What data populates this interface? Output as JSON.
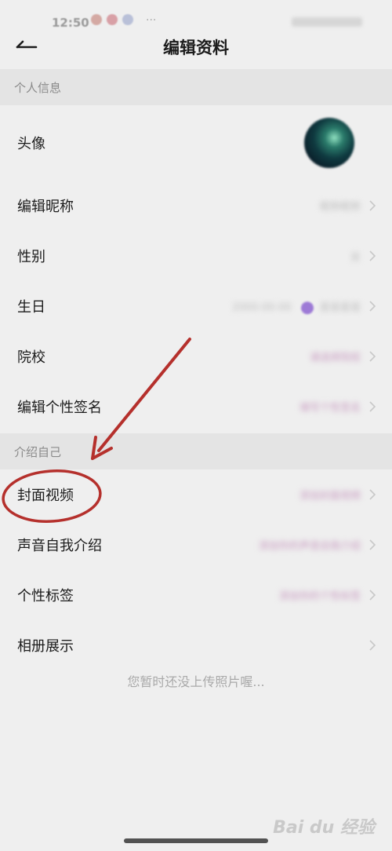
{
  "status_bar": {
    "time": "12:50",
    "more": "···"
  },
  "header": {
    "title": "编辑资料"
  },
  "sections": {
    "personal": {
      "title": "个人信息"
    },
    "intro": {
      "title": "介绍自己"
    }
  },
  "rows": {
    "avatar": {
      "label": "头像"
    },
    "nickname": {
      "label": "编辑昵称",
      "value": "昵称昵称"
    },
    "gender": {
      "label": "性别",
      "value": "女"
    },
    "birthday": {
      "label": "生日",
      "value": "2000-00-00",
      "sign": "星座星座"
    },
    "school": {
      "label": "院校",
      "value": "请选择院校"
    },
    "signature": {
      "label": "编辑个性签名",
      "value": "填写个性签名"
    },
    "cover_video": {
      "label": "封面视频",
      "value": "添加封面视频"
    },
    "voice_intro": {
      "label": "声音自我介绍",
      "value": "添加你的声音自我介绍"
    },
    "tags": {
      "label": "个性标签",
      "value": "添加你的个性标签"
    },
    "album": {
      "label": "相册展示",
      "empty_text": "您暂时还没上传照片喔..."
    }
  },
  "watermark": "Bai du 经验",
  "colors": {
    "annotation": "#b5302c",
    "value_pink": "#c89ac0",
    "section_bg": "#e4e4e4"
  }
}
